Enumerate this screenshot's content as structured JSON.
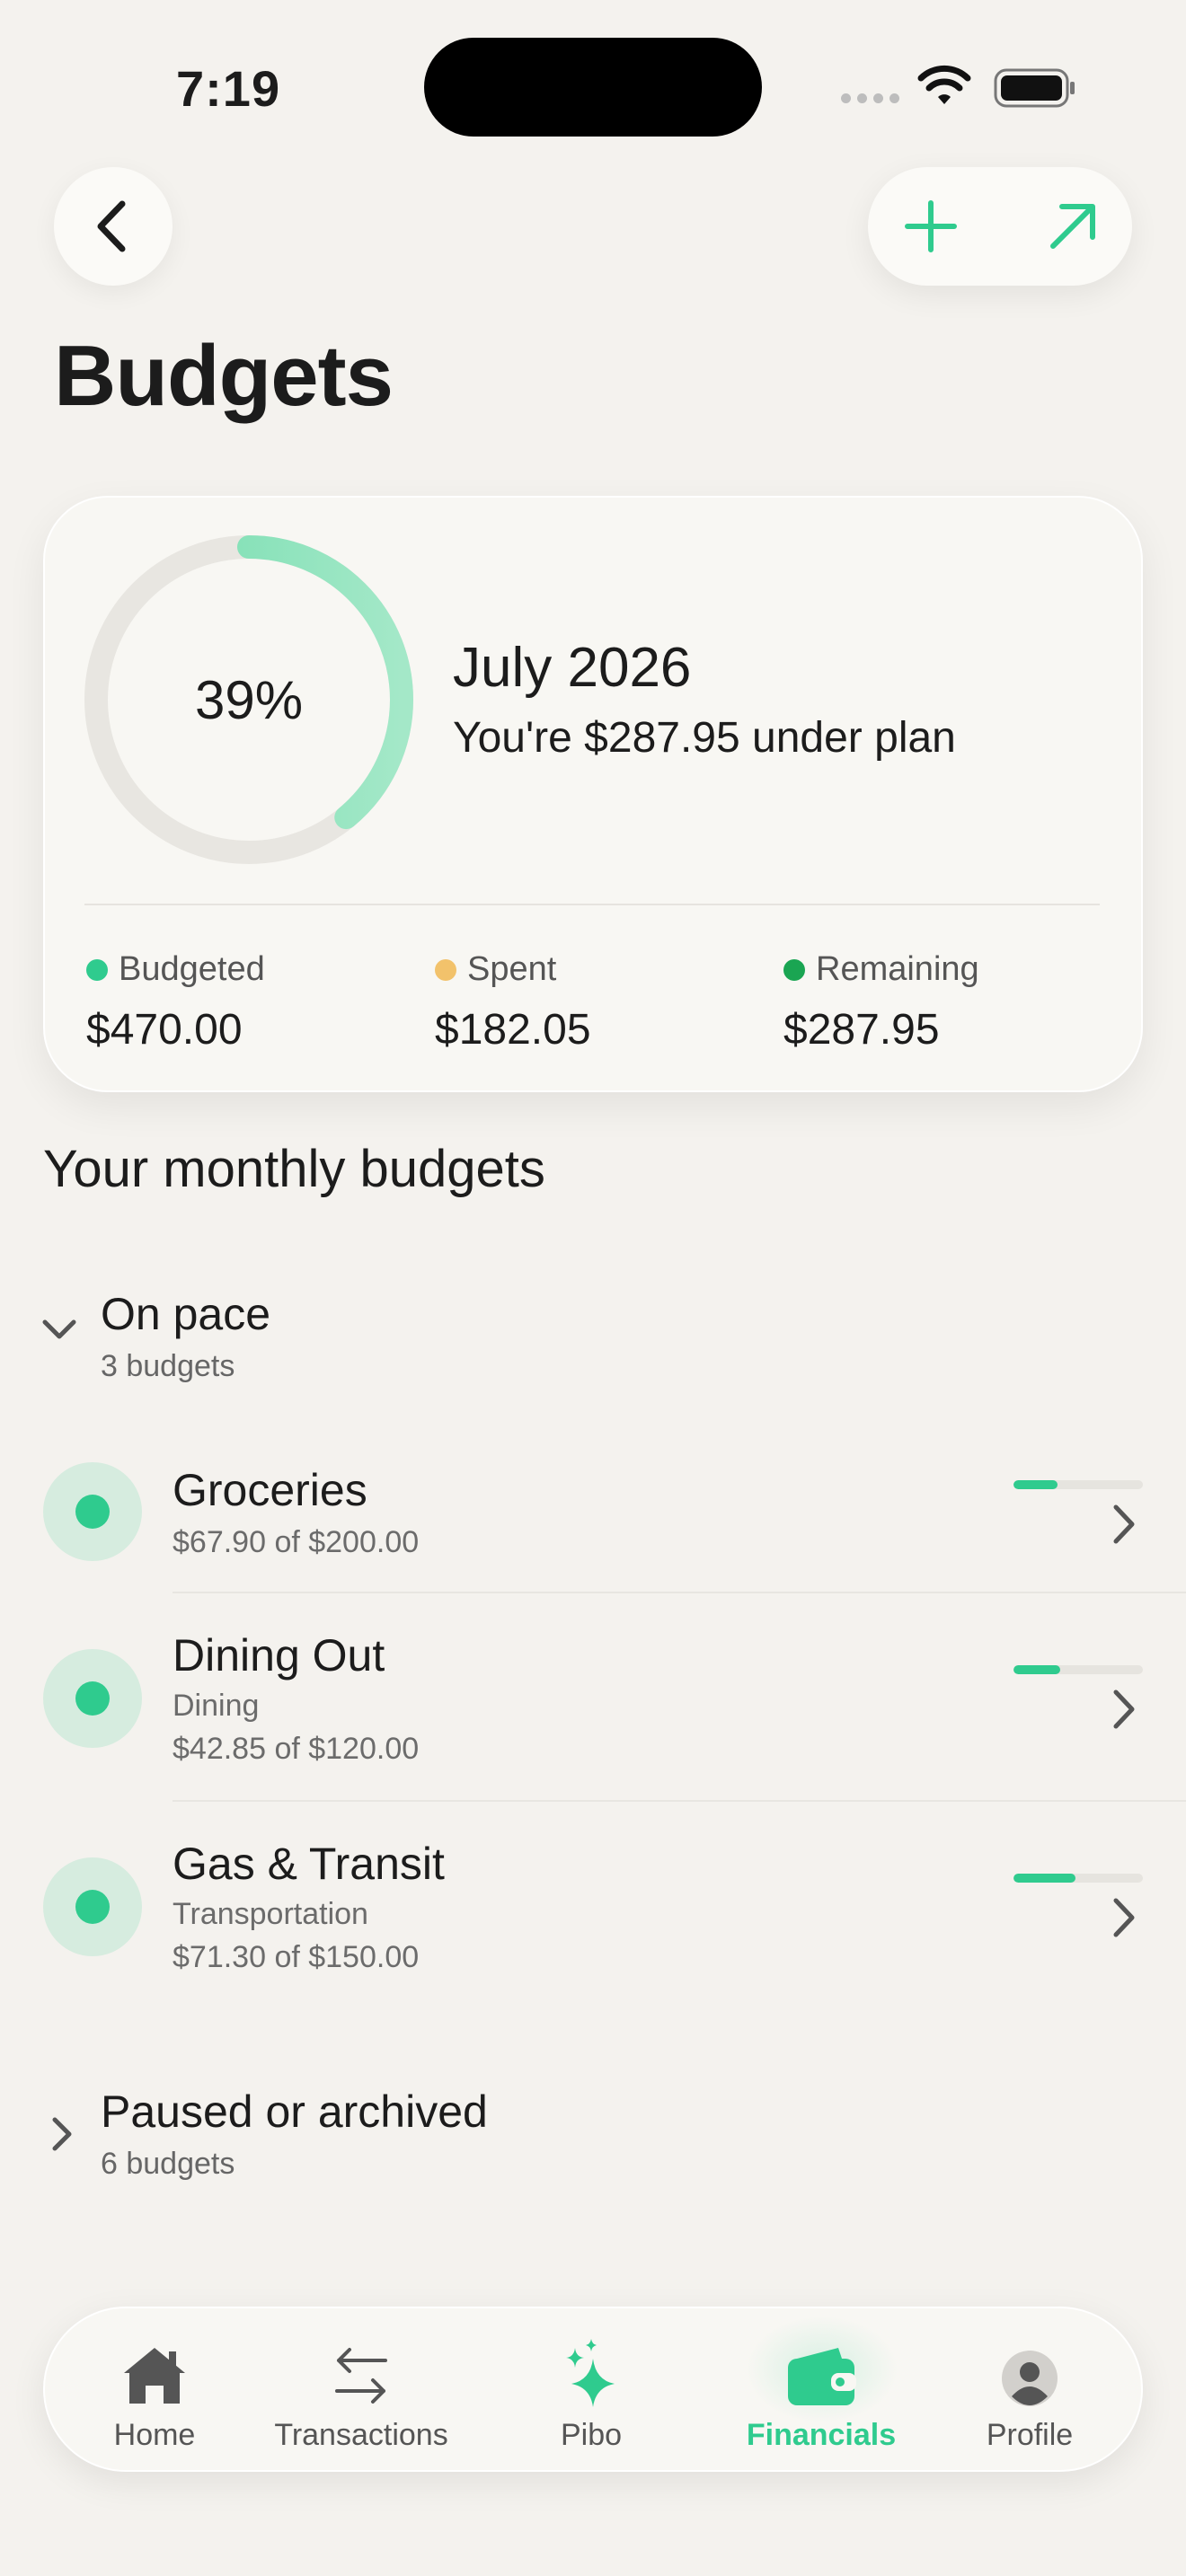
{
  "status_bar": {
    "time": "7:19"
  },
  "header": {
    "title": "Budgets"
  },
  "summary": {
    "progress_label": "39%",
    "progress_fraction": 0.39,
    "month": "July 2026",
    "status_text": "You're $287.95 under plan",
    "stats": [
      {
        "label": "Budgeted",
        "value": "$470.00",
        "color": "#2fcb8e"
      },
      {
        "label": "Spent",
        "value": "$182.05",
        "color": "#f2c26b"
      },
      {
        "label": "Remaining",
        "value": "$287.95",
        "color": "#1aa552"
      }
    ]
  },
  "section": {
    "title": "Your monthly budgets"
  },
  "groups": [
    {
      "title": "On pace",
      "subtitle": "3 budgets",
      "expanded": true
    },
    {
      "title": "Paused or archived",
      "subtitle": "6 budgets",
      "expanded": false
    }
  ],
  "budgets": [
    {
      "name": "Groceries",
      "category": "",
      "amount": "$67.90 of $200.00",
      "progress": 0.34
    },
    {
      "name": "Dining Out",
      "category": "Dining",
      "amount": "$42.85 of $120.00",
      "progress": 0.36
    },
    {
      "name": "Gas & Transit",
      "category": "Transportation",
      "amount": "$71.30 of $150.00",
      "progress": 0.48
    }
  ],
  "tabs": [
    {
      "label": "Home",
      "icon": "home-icon",
      "active": false
    },
    {
      "label": "Transactions",
      "icon": "transfer-arrows-icon",
      "active": false
    },
    {
      "label": "Pibo",
      "icon": "sparkle-icon",
      "active": false
    },
    {
      "label": "Financials",
      "icon": "wallet-icon",
      "active": true
    },
    {
      "label": "Profile",
      "icon": "profile-icon",
      "active": false
    }
  ],
  "colors": {
    "accent": "#2fcb8e",
    "background": "#f4f2ee",
    "card": "#f8f7f3"
  }
}
